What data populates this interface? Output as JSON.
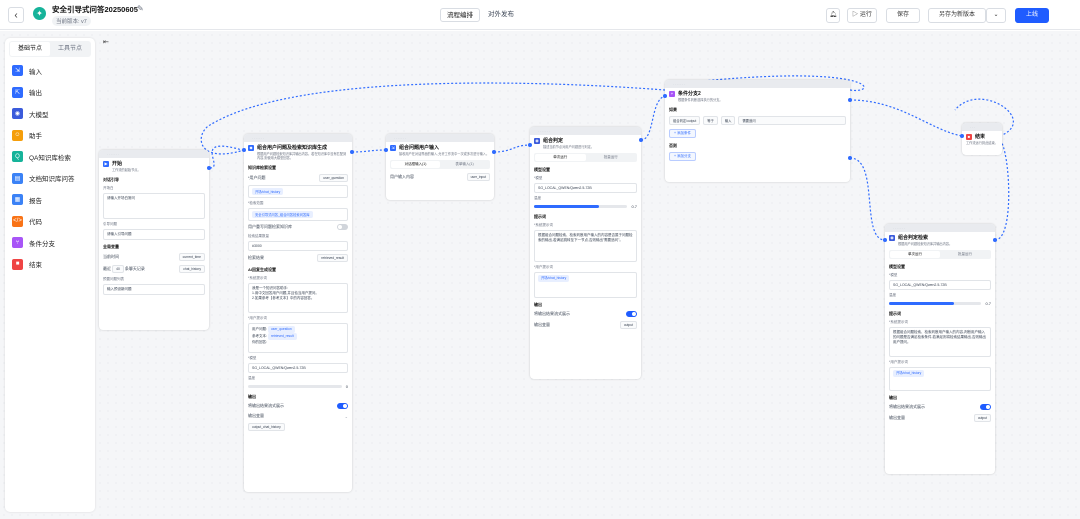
{
  "header": {
    "back_icon": "chevron-left-icon",
    "app_name": "安全引导式问答20250605",
    "version": "当前版本: v7",
    "tabs": [
      "流程编排",
      "对外发布"
    ],
    "actions": {
      "run": "运行",
      "save": "保存",
      "save_as": "另存为新版本",
      "publish": "上线"
    },
    "accent": "#1f5cff"
  },
  "sidebar": {
    "tabs": [
      "基础节点",
      "工具节点"
    ],
    "items": [
      {
        "label": "输入",
        "icon": "input-icon",
        "color": "#2f6bff"
      },
      {
        "label": "输出",
        "icon": "output-icon",
        "color": "#2f6bff"
      },
      {
        "label": "大模型",
        "icon": "model-icon",
        "color": "#3b5bdb"
      },
      {
        "label": "助手",
        "icon": "assistant-icon",
        "color": "#f59e0b"
      },
      {
        "label": "QA知识库检索",
        "icon": "qa-icon",
        "color": "#16b39a"
      },
      {
        "label": "文档知识库问答",
        "icon": "doc-icon",
        "color": "#3b82f6"
      },
      {
        "label": "报告",
        "icon": "report-icon",
        "color": "#3b82f6"
      },
      {
        "label": "代码",
        "icon": "code-icon",
        "color": "#f97316"
      },
      {
        "label": "条件分支",
        "icon": "branch-icon",
        "color": "#a855f7"
      },
      {
        "label": "结束",
        "icon": "end-icon",
        "color": "#ef4444"
      }
    ]
  },
  "nodes": {
    "start": {
      "title": "开始",
      "desc": "工作流的起始节点。",
      "input_section": "对话引导",
      "opening_label": "开场白",
      "opening_text": "请输入开场白常问",
      "guide_label": "引导问题",
      "guide_placeholder": "请输入引导问题",
      "global_section": "全局变量",
      "var1_label": "当前时间",
      "var1_value": "current_time",
      "hist_prefix": "最近",
      "hist_count": "40",
      "hist_suffix": "条聊天记录",
      "hist_value": "chat_history",
      "preset_label": "预置问题列表",
      "preset_placeholder": "输入预设新问题"
    },
    "combo1": {
      "title": "组合用户问题及检索知识库生成",
      "desc": "根据用户问题检索知识库并输出内容。若在知识库中没有匹配到内容,则使用大模型回答。",
      "kb_section": "知识库检索设置",
      "q_label": "*用户问题",
      "q_value": "user_question",
      "hist_chip": "开场/chat_history",
      "kb_label": "*检索范围",
      "kb_chip": "安全引导式问答_组合问答检索问答库",
      "rerank_label": "用户重写问题检索知识库",
      "topk_label": "检索结果数量",
      "topk_value": "#3000",
      "result_label": "检索结果",
      "result_value": "retrieved_result",
      "ai_section": "AI回复生成设置",
      "prompt_label": "*系统提示词",
      "prompt_text": "我是一个知识问答助手:\n1.用中文回答用户问题,并且恰当用户提问。\n2.如果参考【参考文本】中的内容回答。",
      "user_prompt_label": "*用户提示词",
      "user_prompt_q": "用户问题:",
      "user_prompt_q_chip": "user_question",
      "user_prompt_ref": "参考文本:",
      "user_prompt_ref_chip": "retrieved_result",
      "user_prompt_ans": "你的回答:",
      "model_label": "*模型",
      "model_value": "SG_LOCAL_QWEN/Qwen2.5-72B",
      "temp_label": "温度",
      "temp_value": 0,
      "output_section": "输出",
      "stream_label": "将输出结果流式展示",
      "output_var_label": "输出变量",
      "output_var_value": "output_chat_history"
    },
    "user_input": {
      "title": "组合问题用户输入",
      "desc": "接收用户在对话界面的输入,允许工作流中一次或多次进行输入。",
      "seg": [
        "对话框输入(1)",
        "表单输入(1)"
      ],
      "var_label": "用户输入内容",
      "var_value": "user_input"
    },
    "judge": {
      "title": "组合判定",
      "desc": "描述当前节点对用户问题进行判定。",
      "seg": [
        "单次运行",
        "批量运行"
      ],
      "model_section": "模型设置",
      "model_label": "*模型",
      "model_value": "SG_LOCAL_QWEN/Qwen2.5-72B",
      "temp_label": "温度",
      "temp_value": 0.7,
      "prompt_section": "提示词",
      "prompt_label": "*系统提示词",
      "prompt_text": "根据组合问题检索、检索判断用户输入的内容是否属于问题检索的输出,若满足跳转至下一节点,否则输出\"需要追问\"。",
      "user_prompt_label": "*用户提示词",
      "user_chip": "开场/chat_history",
      "output_section": "输出",
      "stream_label": "将输出结果流式展示",
      "output_var_label": "输出变量",
      "output_var_value": "output"
    },
    "branch": {
      "title": "条件分支2",
      "desc": "根据条件判断选择执行的分支。",
      "if_label": "如果",
      "cond_left": "组合判定/output",
      "cond_op": "等于",
      "cond_type": "输入",
      "cond_right": "需要追问",
      "add_cond": "+ 添加条件",
      "else_label": "否则",
      "add_branch": "+ 添加分支"
    },
    "end": {
      "title": "结束",
      "desc": "工作流运行到此结束。"
    },
    "combo2": {
      "title": "组合判定检索",
      "desc": "根据用户问题检索知识库并输出内容。",
      "seg": [
        "单次运行",
        "批量运行"
      ],
      "model_section": "模型设置",
      "model_label": "*模型",
      "model_value": "SG_LOCAL_QWEN/Qwen2.5-72B",
      "temp_label": "温度",
      "temp_value": 0.7,
      "prompt_section": "提示词",
      "prompt_label": "*系统提示词",
      "prompt_text": "根据组合问题检索、检索判断用户输入的内容,判断用户输入的问题是否满足检索条件,若满足则将检索结果输出,否则输出用户提问。",
      "user_prompt_label": "*用户提示词",
      "user_chip": "开场/chat_history",
      "output_section": "输出",
      "stream_label": "将输出结果流式展示",
      "output_var_label": "输出变量",
      "output_var_value": "output"
    }
  }
}
